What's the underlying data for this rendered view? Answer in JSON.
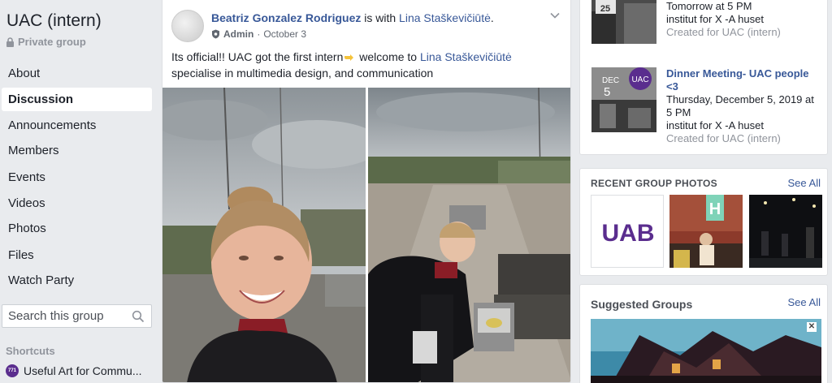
{
  "group": {
    "name": "UAC (intern)",
    "privacy": "Private group"
  },
  "nav": {
    "items": [
      {
        "label": "About"
      },
      {
        "label": "Discussion"
      },
      {
        "label": "Announcements"
      },
      {
        "label": "Members"
      },
      {
        "label": "Events"
      },
      {
        "label": "Videos"
      },
      {
        "label": "Photos"
      },
      {
        "label": "Files"
      },
      {
        "label": "Watch Party"
      }
    ],
    "active": "Discussion"
  },
  "search": {
    "placeholder": "Search this group"
  },
  "shortcuts": {
    "heading": "Shortcuts",
    "items": [
      {
        "label": "Useful Art for Commu...",
        "avatar_text": "771"
      }
    ]
  },
  "post": {
    "author": "Beatriz Gonzalez Rodriguez",
    "with_text": " is with ",
    "tagged": "Lina Staškevičiūtė",
    "period": ".",
    "role": "Admin",
    "separator": "·",
    "date": "October 3",
    "text_part1": "Its official!! UAC got the first intern",
    "text_part2": " welcome to ",
    "text_link": "Lina Staškevičiūtė",
    "text_line2": "specialise in multimedia design, and communication"
  },
  "events": [
    {
      "lines": [
        "Tomorrow at 5 PM",
        "institut for X -A huset"
      ],
      "created": "Created for UAC (intern)",
      "thumb_text": "25"
    },
    {
      "title": "Dinner Meeting- UAC people <3",
      "lines": [
        "Thursday, December 5, 2019 at 5 PM",
        "institut for X -A huset"
      ],
      "created": "Created for UAC (intern)",
      "thumb_month": "DEC",
      "thumb_day": "5",
      "thumb_logo": "UAC"
    }
  ],
  "recent_photos": {
    "heading": "RECENT GROUP PHOTOS",
    "see_all": "See All",
    "logo_text": "UAB"
  },
  "suggested": {
    "heading": "Suggested Groups",
    "see_all": "See All",
    "close": "✕"
  },
  "colors": {
    "link": "#385898",
    "background": "#e9ebee",
    "logo_purple": "#5a2d8e"
  }
}
